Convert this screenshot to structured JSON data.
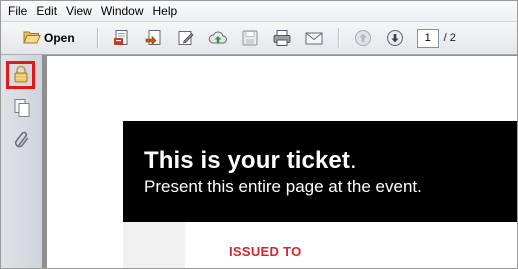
{
  "menu": {
    "items": [
      "File",
      "Edit",
      "View",
      "Window",
      "Help"
    ]
  },
  "toolbar": {
    "open_label": "Open",
    "icons": [
      "folder-open-icon",
      "create-pdf-icon",
      "export-icon",
      "edit-icon",
      "upload-cloud-icon",
      "save-icon",
      "print-icon",
      "email-icon",
      "previous-page-icon",
      "next-page-icon"
    ],
    "page_current": "1",
    "page_total": "/ 2"
  },
  "left_nav": {
    "icons": [
      "lock-icon",
      "pages-icon",
      "paperclip-icon"
    ],
    "accent_color": "#e0191b"
  },
  "document": {
    "title_main": "This is your ticket",
    "title_dot": ".",
    "subtitle": "Present this entire page at the event.",
    "issued_to_label": "ISSUED TO",
    "issued_color": "#d9232a"
  }
}
